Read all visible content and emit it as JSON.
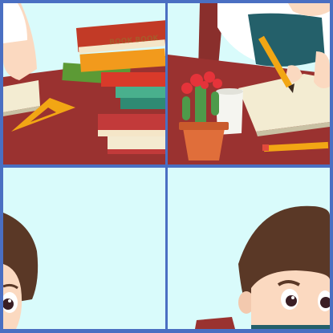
{
  "puzzle": {
    "rows": 2,
    "cols": 2,
    "tiles": [
      {
        "index": 0,
        "content": "books-and-ruler"
      },
      {
        "index": 1,
        "content": "writing-and-cactus"
      },
      {
        "index": 2,
        "content": "boy-face-edge"
      },
      {
        "index": 3,
        "content": "boy-face-peeking"
      }
    ]
  },
  "book_spine_label": "BOOK BOOK",
  "colors": {
    "frame": "#4a6fc2",
    "sky": "#d9fbfb",
    "desk": "#9a3230",
    "hair": "#5a3826",
    "skin": "#fbd9c0"
  }
}
